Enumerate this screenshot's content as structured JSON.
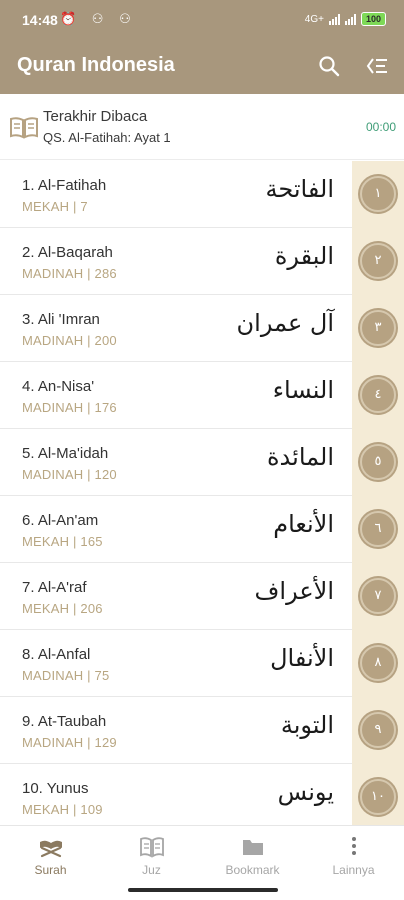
{
  "status_bar": {
    "time": "14:48",
    "left_icons": "⏰ ⚇ ⚇",
    "network": "4G+",
    "battery": "100"
  },
  "app_bar": {
    "title": "Quran Indonesia",
    "search_icon": "search-icon",
    "sort_icon": "sort-icon"
  },
  "last_read": {
    "title": "Terakhir Dibaca",
    "subtitle": "QS. Al-Fatihah: Ayat 1",
    "time": "00:00",
    "icon": "open-book-icon"
  },
  "surahs": [
    {
      "name": "1. Al-Fatihah",
      "info": "MEKAH | 7",
      "arabic": "الفاتحة",
      "number": "١"
    },
    {
      "name": "2. Al-Baqarah",
      "info": "MADINAH | 286",
      "arabic": "البقرة",
      "number": "٢"
    },
    {
      "name": "3. Ali 'Imran",
      "info": "MADINAH | 200",
      "arabic": "آل عمران",
      "number": "٣"
    },
    {
      "name": "4. An-Nisa'",
      "info": "MADINAH | 176",
      "arabic": "النساء",
      "number": "٤"
    },
    {
      "name": "5. Al-Ma'idah",
      "info": "MADINAH | 120",
      "arabic": "المائدة",
      "number": "٥"
    },
    {
      "name": "6. Al-An'am",
      "info": "MEKAH | 165",
      "arabic": "الأنعام",
      "number": "٦"
    },
    {
      "name": "7. Al-A'raf",
      "info": "MEKAH | 206",
      "arabic": "الأعراف",
      "number": "٧"
    },
    {
      "name": "8. Al-Anfal",
      "info": "MADINAH | 75",
      "arabic": "الأنفال",
      "number": "٨"
    },
    {
      "name": "9. At-Taubah",
      "info": "MADINAH | 129",
      "arabic": "التوبة",
      "number": "٩"
    },
    {
      "name": "10. Yunus",
      "info": "MEKAH | 109",
      "arabic": "يونس",
      "number": "١٠"
    }
  ],
  "bottom_nav": [
    {
      "label": "Surah",
      "icon": "quran-stand-icon",
      "active": true
    },
    {
      "label": "Juz",
      "icon": "book-icon",
      "active": false
    },
    {
      "label": "Bookmark",
      "icon": "folder-icon",
      "active": false
    },
    {
      "label": "Lainnya",
      "icon": "more-vertical-icon",
      "active": false
    }
  ],
  "colors": {
    "primary": "#a8977d",
    "badge": "#b6a282",
    "badge_column": "#f4ebd6",
    "subtitle": "#b8a682",
    "time": "#3f9d77"
  }
}
